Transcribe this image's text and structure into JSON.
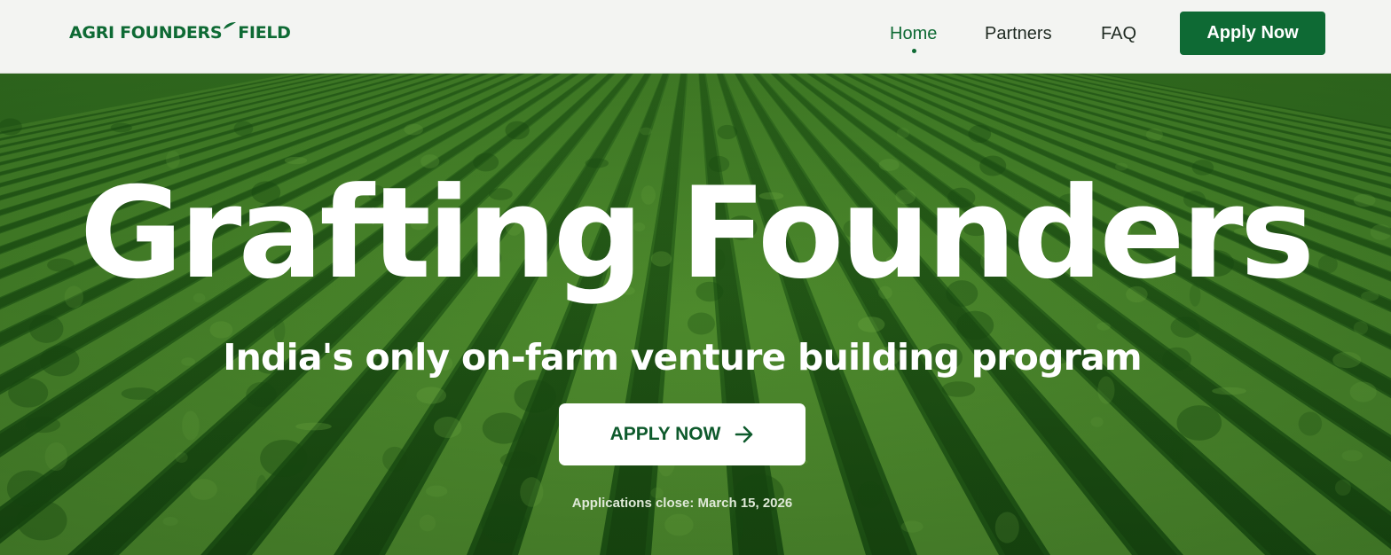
{
  "header": {
    "logo": {
      "part1": "AGRI FOUNDERS",
      "part2": "FIELD"
    },
    "nav": [
      {
        "label": "Home",
        "active": true
      },
      {
        "label": "Partners",
        "active": false
      },
      {
        "label": "FAQ",
        "active": false
      }
    ],
    "apply_label": "Apply Now"
  },
  "hero": {
    "title": "Grafting Founders",
    "subtitle": "India's only on-farm venture building program",
    "cta_label": "APPLY NOW",
    "deadline": "Applications close: March 15, 2026"
  },
  "colors": {
    "brand_green": "#0e6a34",
    "header_bg": "#f3f4f2",
    "hero_green": "#2f6a1d",
    "white": "#ffffff"
  },
  "icons": {
    "logo_leaf": "leaf-icon",
    "cta_arrow": "arrow-right-icon",
    "active_indicator": "dot-icon"
  }
}
